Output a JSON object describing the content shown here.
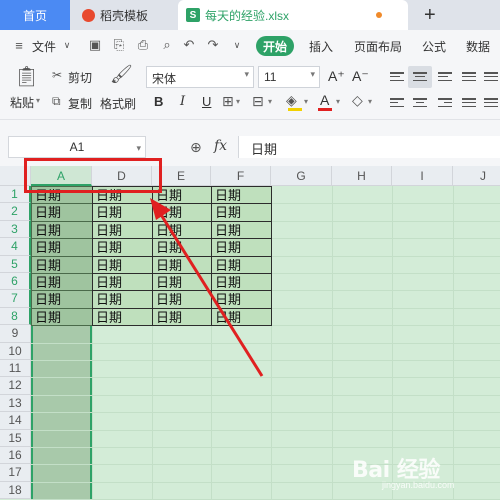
{
  "tabs": {
    "home": "首页",
    "daoke": "稻壳模板",
    "file_icon": "S",
    "file": "每天的经验.xlsx",
    "new_tab": "+"
  },
  "menu": {
    "file": "文件",
    "start": "开始",
    "insert": "插入",
    "page_layout": "页面布局",
    "formula": "公式",
    "data": "数据"
  },
  "ribbon": {
    "cut": "剪切",
    "paste": "粘贴",
    "copy": "复制",
    "format_painter": "格式刷",
    "font_name": "宋体",
    "font_size": "11",
    "bold": "B",
    "italic": "I",
    "underline": "U",
    "grow": "A⁺",
    "shrink": "A⁻"
  },
  "formula_bar": {
    "name_box": "A1",
    "fx": "fx",
    "content": "日期"
  },
  "grid": {
    "columns": [
      "A",
      "D",
      "E",
      "F",
      "G",
      "H",
      "I",
      "J"
    ],
    "rows": [
      "1",
      "2",
      "3",
      "4",
      "5",
      "6",
      "7",
      "8",
      "9",
      "10",
      "11",
      "12",
      "13",
      "14",
      "15",
      "16",
      "17",
      "18"
    ],
    "cell_text": "日期"
  },
  "watermark": {
    "brand": "Bai 经验",
    "sub": "jingyan.baidu.com"
  },
  "colors": {
    "accent": "#2ea267",
    "tab_active": "#4b8af3",
    "annotation": "#e02020",
    "sheet_bg": "#d3ecd7"
  }
}
